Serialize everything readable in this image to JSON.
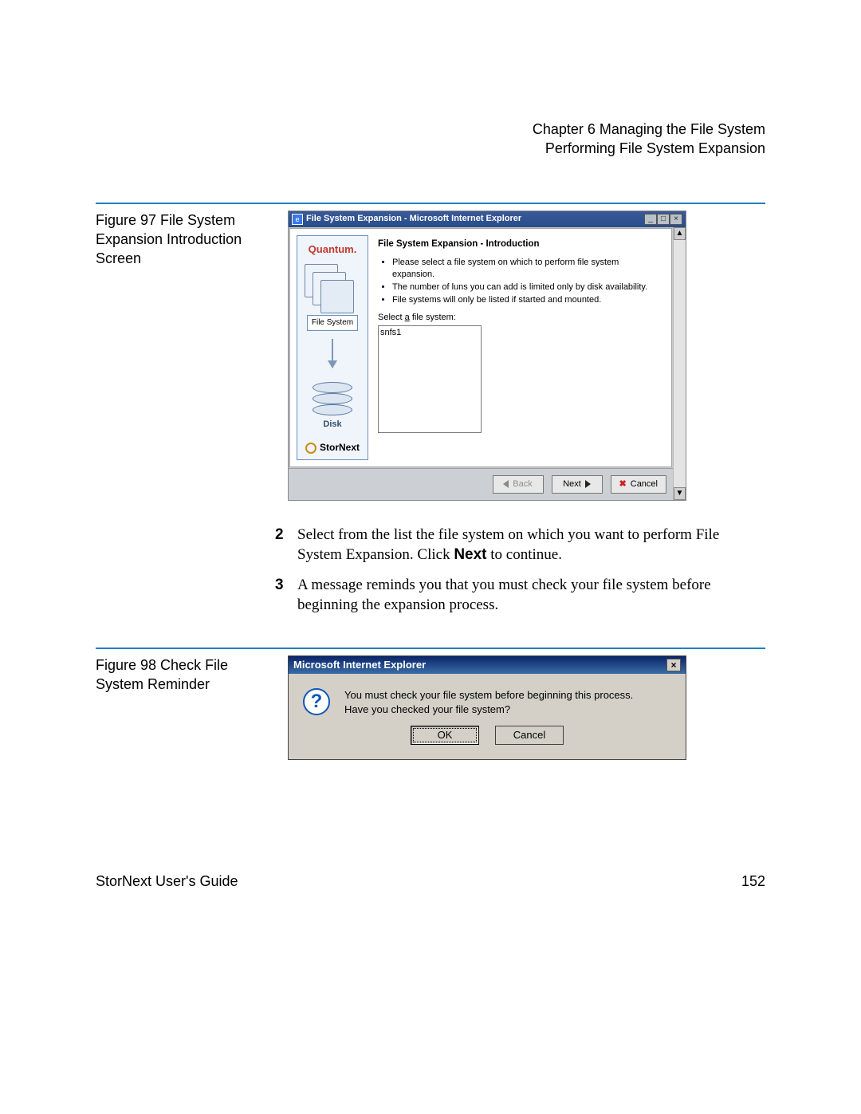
{
  "header": {
    "chapter": "Chapter 6  Managing the File System",
    "section": "Performing File System Expansion"
  },
  "figure97": {
    "caption": "Figure 97  File System Expansion Introduction Screen"
  },
  "figure98": {
    "caption": "Figure 98  Check File System Reminder"
  },
  "ie": {
    "title": "File System Expansion - Microsoft Internet Explorer",
    "sidebar": {
      "brand": "Quantum.",
      "fs_label": "File System",
      "disk_label": "Disk",
      "product": "StorNext"
    },
    "main": {
      "heading": "File System Expansion - Introduction",
      "bullet1": "Please select a file system on which to perform file system expansion.",
      "bullet2": "The number of luns you can add is limited only by disk availability.",
      "bullet3": "File systems will only be listed if started and mounted.",
      "select_label_pre": "Select ",
      "select_label_u": "a",
      "select_label_post": " file system:",
      "option1": "snfs1"
    },
    "buttons": {
      "back": "Back",
      "next": "Next",
      "cancel": "Cancel"
    }
  },
  "steps": {
    "s2_pre": "Select from the list the file system on which you want to perform File System Expansion. Click ",
    "s2_next": "Next",
    "s2_post": " to continue.",
    "s3": "A message reminds you that you must check your file system before beginning the expansion process."
  },
  "msg": {
    "title": "Microsoft Internet Explorer",
    "line1": "You must check your file system before beginning this process.",
    "line2": "Have you checked your file system?",
    "ok": "OK",
    "cancel": "Cancel"
  },
  "footer": {
    "guide": "StorNext User's Guide",
    "page": "152"
  }
}
